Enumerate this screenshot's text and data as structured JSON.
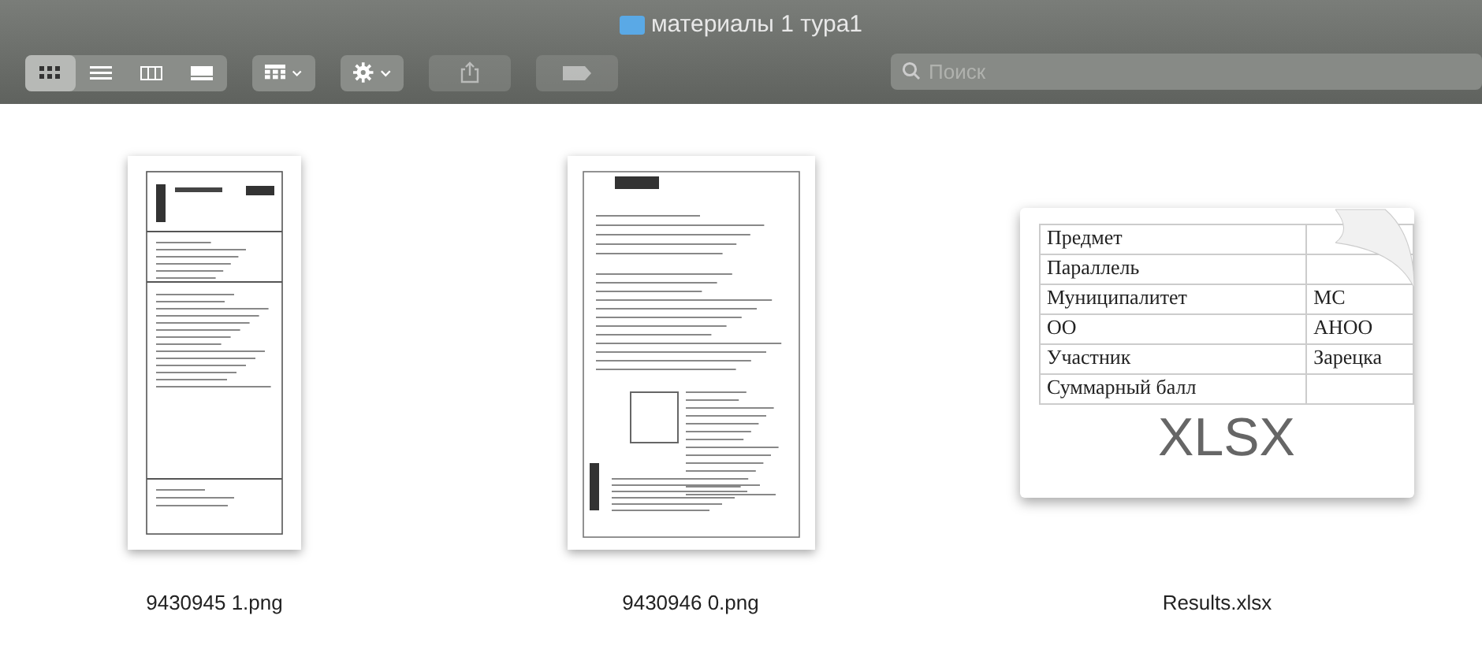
{
  "window": {
    "title": "материалы 1 тура1"
  },
  "toolbar": {
    "view_modes": [
      {
        "kind": "icons",
        "selected": true
      },
      {
        "kind": "list",
        "selected": false
      },
      {
        "kind": "columns",
        "selected": false
      },
      {
        "kind": "gallery",
        "selected": false
      }
    ],
    "buttons": [
      {
        "kind": "group",
        "disabled": false
      },
      {
        "kind": "action",
        "disabled": false
      },
      {
        "kind": "share",
        "disabled": true
      },
      {
        "kind": "tags",
        "disabled": true
      }
    ],
    "search": {
      "placeholder": "Поиск"
    }
  },
  "files": [
    {
      "kind": "scan",
      "name": "9430945 1.png"
    },
    {
      "kind": "handwritten",
      "name": "9430946 0.png"
    },
    {
      "kind": "xlsx",
      "name": "Results.xlsx",
      "badge": "XLSX",
      "rows": [
        [
          "Предмет",
          ""
        ],
        [
          "Параллель",
          ""
        ],
        [
          "Муниципалитет",
          "МС"
        ],
        [
          "ОО",
          "АНОО"
        ],
        [
          "Участник",
          "Зарецка"
        ],
        [
          "Суммарный балл",
          ""
        ]
      ]
    }
  ]
}
